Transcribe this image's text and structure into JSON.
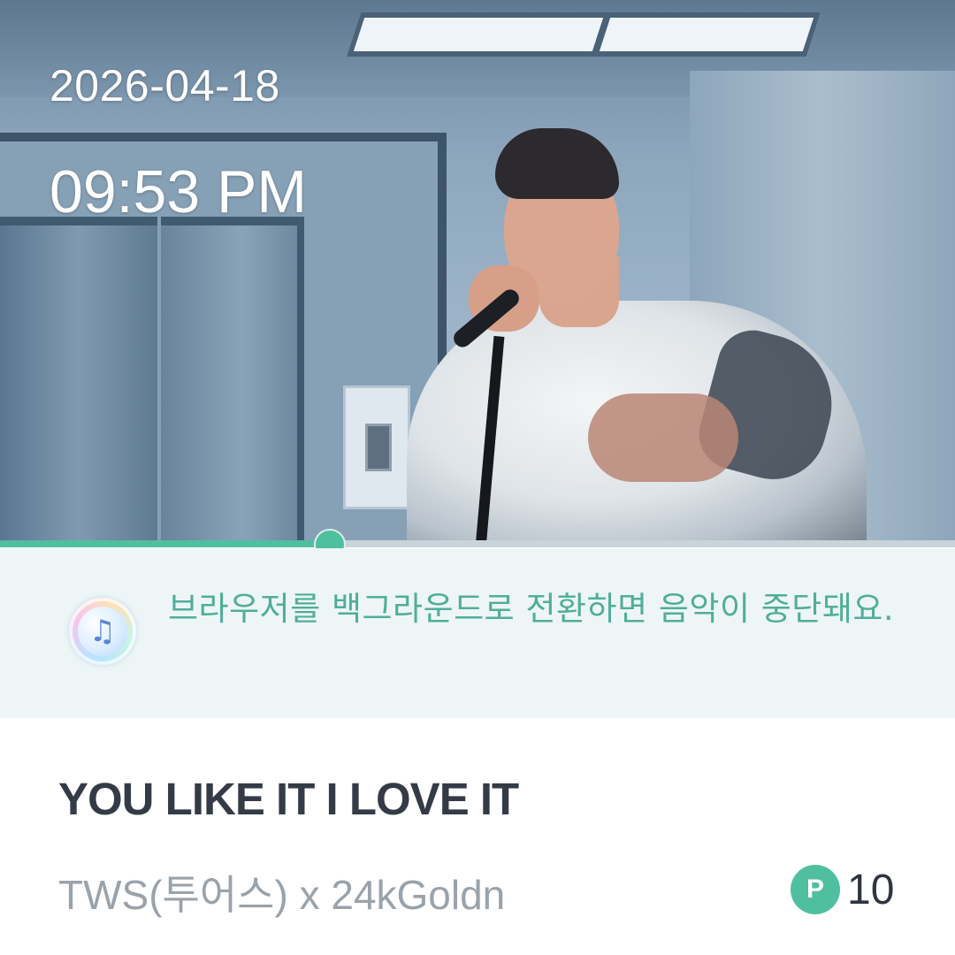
{
  "overlay": {
    "date": "2026-04-18",
    "time": "09:53 PM"
  },
  "player": {
    "progress_fraction": 0.345,
    "accent_color": "#4fbfa0"
  },
  "notice": {
    "icon": "music-note-icon",
    "text": "브라우저를 백그라운드로 전환하면 음악이 중단돼요."
  },
  "song": {
    "title": "YOU LIKE IT I LOVE IT",
    "artist": "TWS(투어스) x 24kGoldn"
  },
  "points": {
    "badge_label": "P",
    "value": "10"
  }
}
